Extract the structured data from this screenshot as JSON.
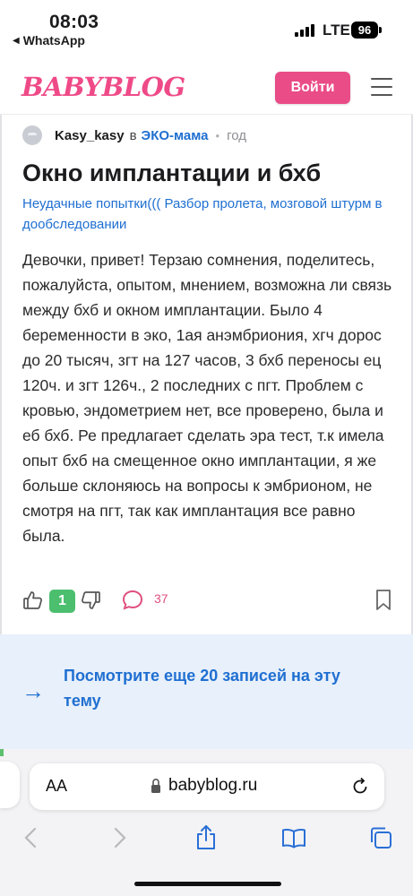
{
  "status_bar": {
    "time": "08:03",
    "back_app": "WhatsApp",
    "network": "LTE",
    "battery": "96"
  },
  "header": {
    "logo": "BABYBLOG",
    "login_label": "Войти"
  },
  "post": {
    "author": "Kasy_kasy",
    "in_word": "в",
    "community": "ЭКО-мама",
    "time_ago": "год",
    "title": "Окно имплантации и бхб",
    "tags": "Неудачные попытки((( Разбор пролета, мозговой штурм в дообследовании",
    "body": "Девочки, привет! Терзаю сомнения, поделитесь, пожалуйста, опытом, мнением, возможна ли связь между бхб и окном имплантации. Было 4 беременности в эко, 1ая анэмбриония, хгч дорос до 20 тысяч, згт на 127 часов, 3 бхб переносы ец 120ч. и згт 126ч., 2 последних с пгт. Проблем с кровью, эндометрием нет, все проверено, была и еб бхб. Ре предлагает сделать эра тест, т.к имела опыт бхб на смещенное окно имплантации, я же больше склоняюсь на вопросы к эмбрионом, не смотря на пгт, так как имплантация все равно была.",
    "likes": "1",
    "comments": "37"
  },
  "more": {
    "text": "Посмотрите еще 20 записей на эту тему"
  },
  "browser": {
    "aa_label": "AA",
    "url": "babyblog.ru"
  },
  "colors": {
    "brand_pink": "#e94c87",
    "link_blue": "#1f6fd1",
    "like_green": "#4cbf6f",
    "more_bg": "#e8f0fb"
  }
}
